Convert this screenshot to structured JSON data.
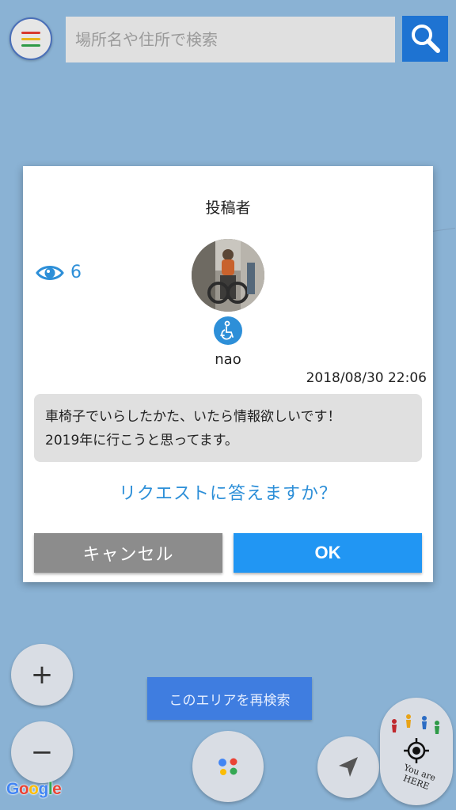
{
  "search": {
    "placeholder": "場所名や住所で検索"
  },
  "dialog": {
    "title": "投稿者",
    "view_count": "6",
    "username": "nao",
    "date": "2018/08/30 22:06",
    "message_line1": "車椅子でいらしたかた、いたら情報欲しいです！",
    "message_line2": "2019年に行こうと思ってます。",
    "question": "リクエストに答えますか？",
    "cancel_label": "キャンセル",
    "ok_label": "OK"
  },
  "map": {
    "zoom_in_label": "+",
    "zoom_out_label": "−",
    "research_label": "このエリアを再検索",
    "google_logo": [
      "G",
      "o",
      "o",
      "g",
      "l",
      "e"
    ],
    "here_label": "You are HERE"
  },
  "colors": {
    "accent": "#2196f3",
    "link": "#2d8fd8",
    "map_background": "#8ab2d4",
    "cancel": "#8c8c8c"
  },
  "icons": {
    "menu": "hamburger-menu-icon",
    "search": "magnifier-icon",
    "views": "eye-icon",
    "wheelchair": "wheelchair-icon",
    "assistant": "google-assistant-icon",
    "navigate": "navigation-arrow-icon",
    "locate": "crosshair-icon"
  }
}
